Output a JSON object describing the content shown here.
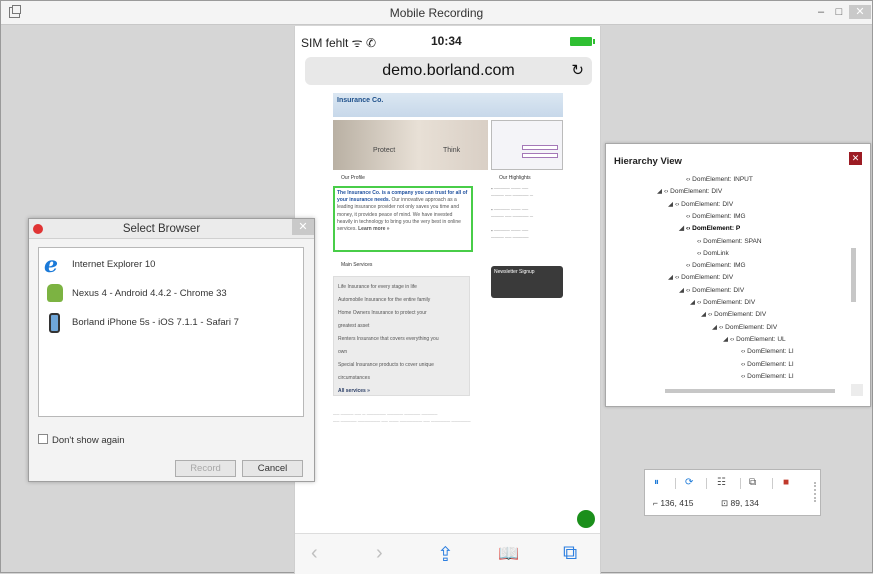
{
  "window": {
    "title": "Mobile Recording",
    "minimize": "–",
    "maximize": "□",
    "close": "✕"
  },
  "phone": {
    "status": {
      "carrier": "SIM fehlt ᯤ ✆",
      "time": "10:34"
    },
    "url": "demo.borland.com",
    "reload_icon": "↻",
    "page": {
      "logo": "Insurance Co.",
      "hero_left": "Protect",
      "hero_right": "Think",
      "highlight_lead": "The Insurance Co. is a company you can trust for all of your insurance needs.",
      "highlight_body": "Our innovative approach as a leading insurance provider not only saves you time and money, it provides peace of mind. We have invested heavily in technology to bring you the very best in online services.",
      "learn_more": "Learn more »",
      "our_profile": "Our Profile",
      "our_highlights": "Our Highlights",
      "main_services": "Main Services",
      "services": [
        "Life Insurance for every stage in life",
        "Automobile Insurance for the entire family",
        "Home Owners Insurance to protect your",
        "greatest asset",
        "Renters Insurance that covers everything you",
        "own",
        "Special Insurance products to cover unique",
        "circumstances"
      ],
      "all_services": "All services »",
      "newsletter": "Newsletter Signup"
    },
    "toolbar": {
      "back": "‹",
      "forward": "›",
      "share": "⇪",
      "bookmarks": "📖",
      "tabs": "⧉"
    }
  },
  "dialog": {
    "title": "Select Browser",
    "close": "✕",
    "browsers": [
      {
        "label": "Internet Explorer 10",
        "icon": "internet-explorer-icon"
      },
      {
        "label": "Nexus 4 - Android 4.4.2 - Chrome 33",
        "icon": "android-icon"
      },
      {
        "label": "Borland iPhone 5s - iOS 7.1.1 - Safari 7",
        "icon": "iphone-icon"
      }
    ],
    "dont_show": "Don't show again",
    "record": "Record",
    "cancel": "Cancel"
  },
  "hierarchy": {
    "title": "Hierarchy View",
    "close": "✕",
    "nodes": [
      {
        "text": "DomElement: INPUT",
        "expander": "",
        "level": 3
      },
      {
        "text": "DomElement: DIV",
        "expander": "◢",
        "level": 1
      },
      {
        "text": "DomElement: DIV",
        "expander": "◢",
        "level": 2
      },
      {
        "text": "DomElement: IMG",
        "expander": "",
        "level": 3
      },
      {
        "text": "DomElement: P",
        "expander": "◢",
        "level": 3,
        "bold": true
      },
      {
        "text": "DomElement: SPAN",
        "expander": "",
        "level": 4
      },
      {
        "text": "DomLink",
        "expander": "",
        "level": 4
      },
      {
        "text": "DomElement: IMG",
        "expander": "",
        "level": 3
      },
      {
        "text": "DomElement: DIV",
        "expander": "◢",
        "level": 2
      },
      {
        "text": "DomElement: DIV",
        "expander": "◢",
        "level": 3
      },
      {
        "text": "DomElement: DIV",
        "expander": "◢",
        "level": 4
      },
      {
        "text": "DomElement: DIV",
        "expander": "◢",
        "level": 5
      },
      {
        "text": "DomElement: DIV",
        "expander": "◢",
        "level": 6
      },
      {
        "text": "DomElement: UL",
        "expander": "◢",
        "level": 7
      },
      {
        "text": "DomElement: LI",
        "expander": "",
        "level": 8
      },
      {
        "text": "DomElement: LI",
        "expander": "",
        "level": 8
      },
      {
        "text": "DomElement: LI",
        "expander": "",
        "level": 8
      }
    ]
  },
  "control": {
    "pause": "⏸",
    "refresh": "⟳",
    "tree": "☷",
    "copy": "⧉",
    "stop": "■",
    "pos_label": "136, 415",
    "size_label": "89, 134"
  },
  "colors": {
    "stop_red": "#c0392b",
    "pause_blue": "#1f7bd8",
    "highlight_green": "#48cd48"
  }
}
